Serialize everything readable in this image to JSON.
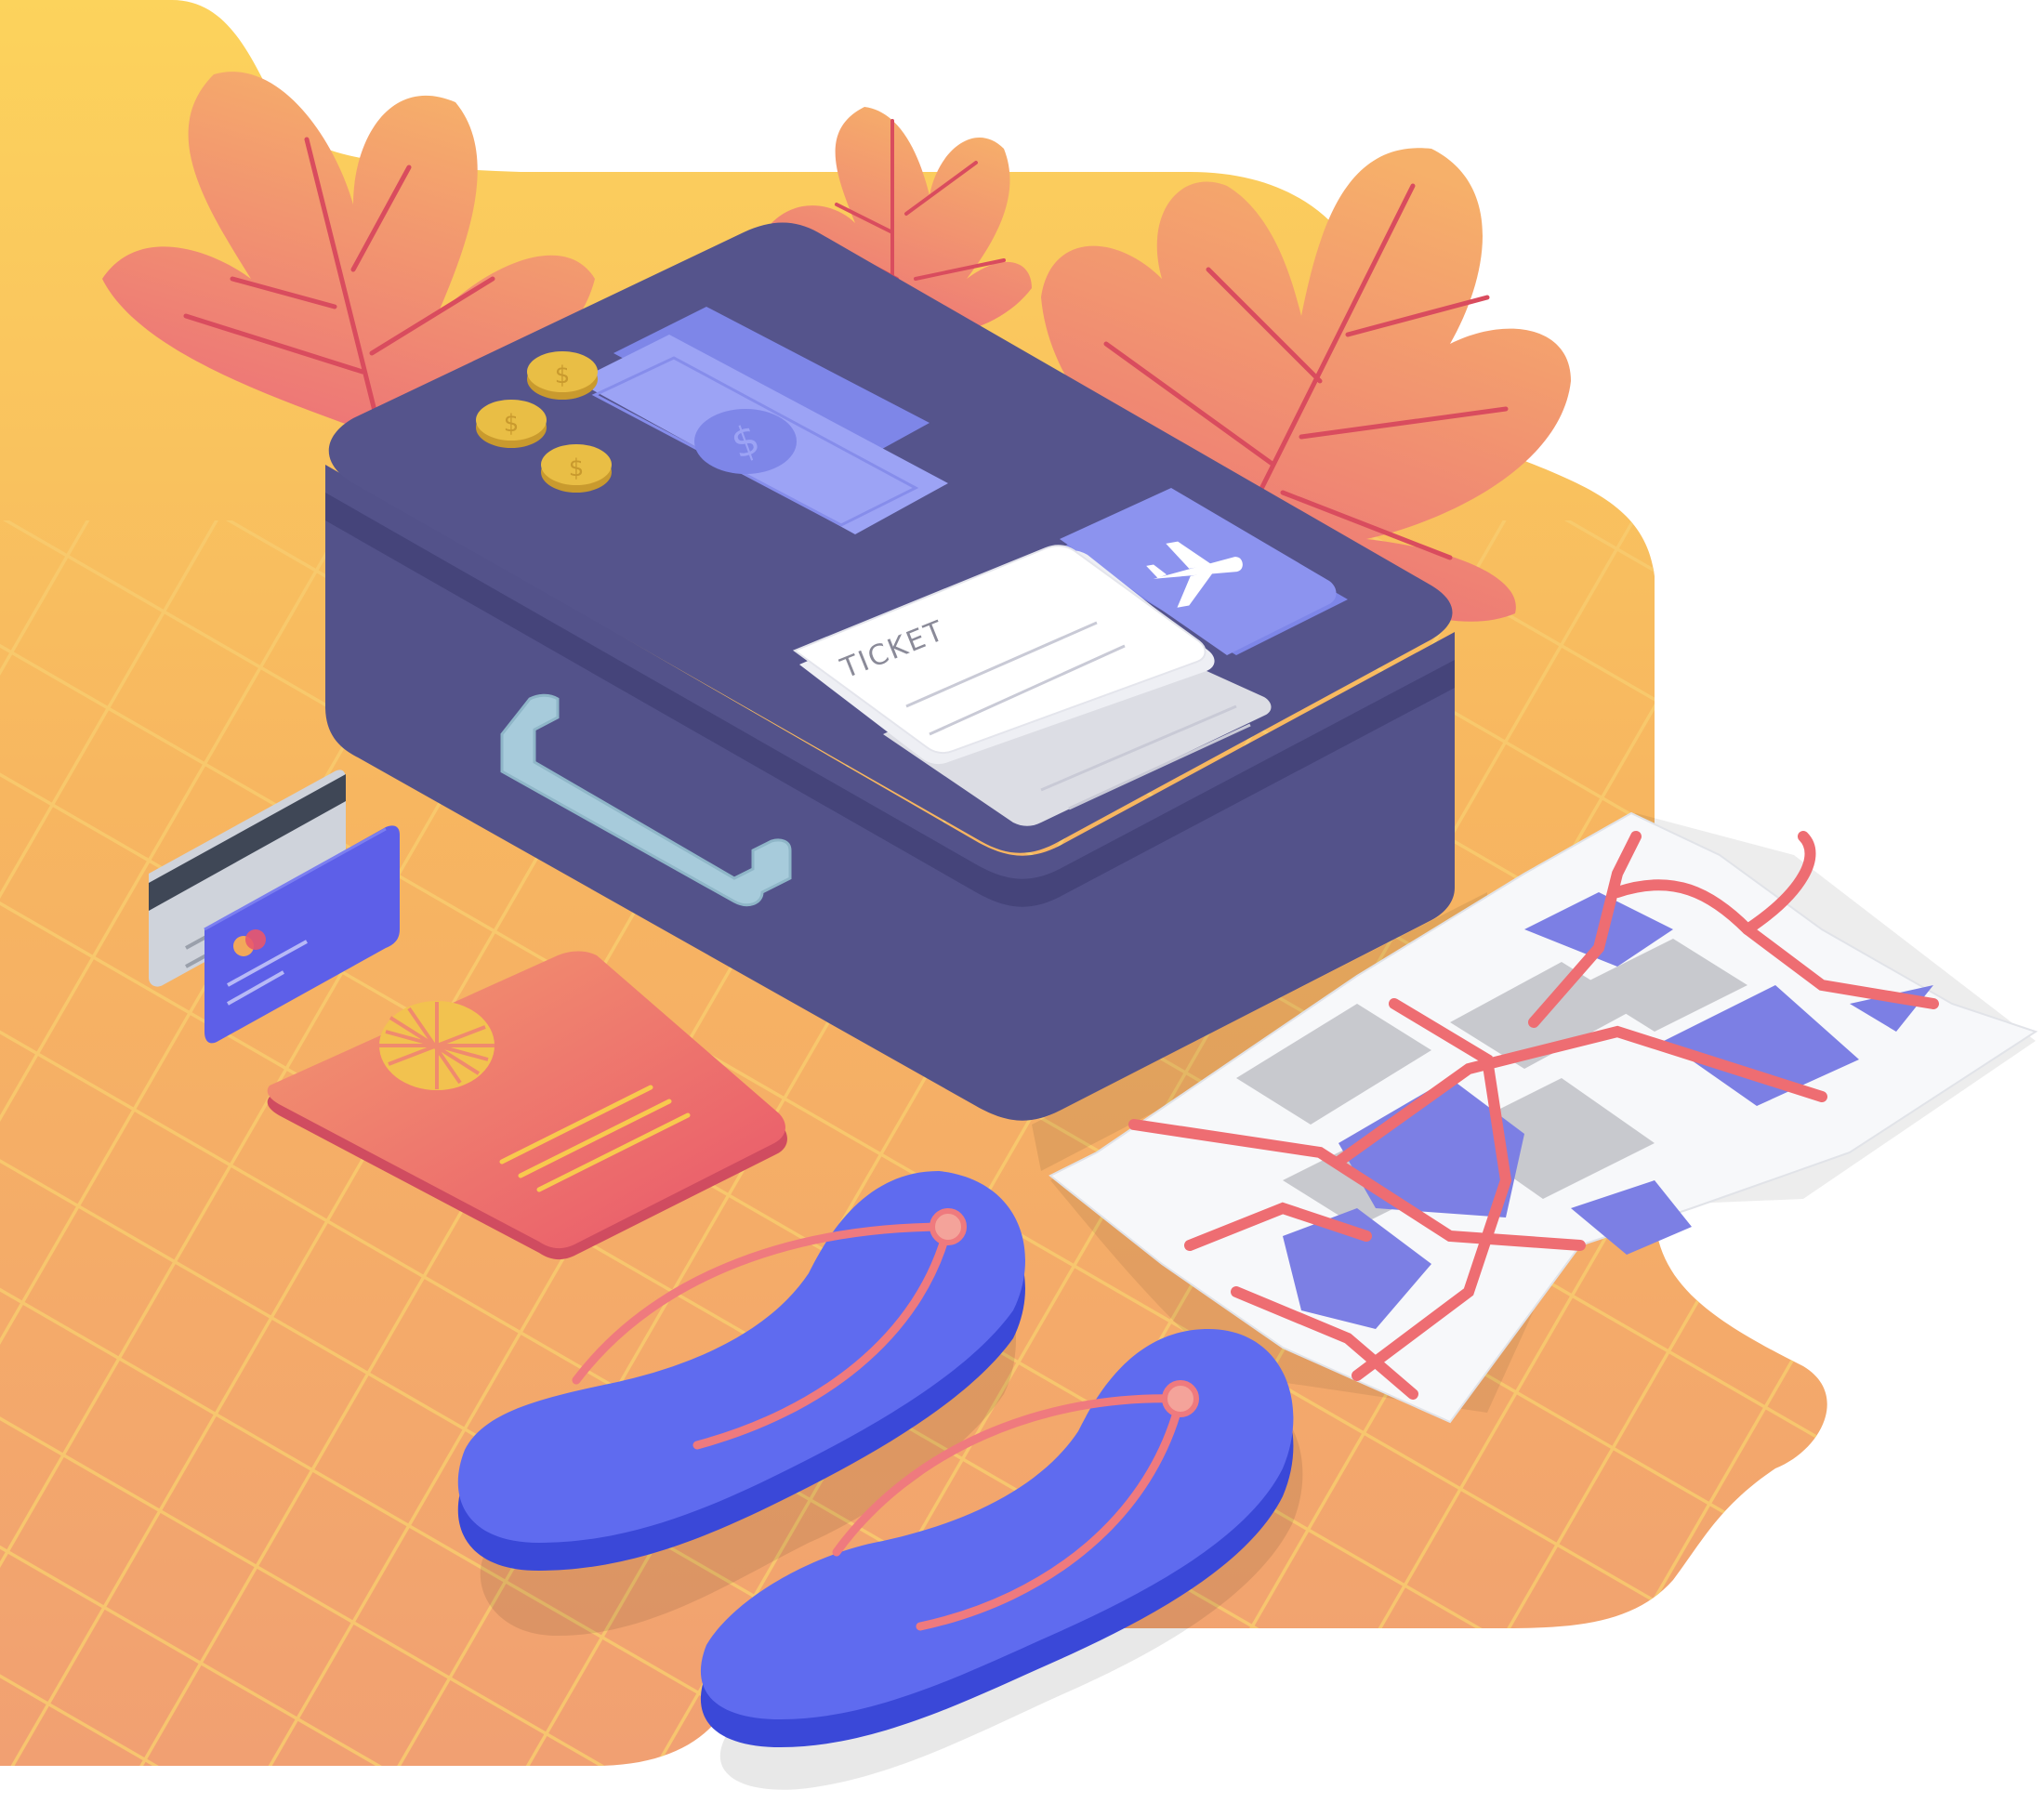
{
  "ticket": {
    "label": "TICKET"
  },
  "money": {
    "currency_symbol": "$"
  },
  "colors": {
    "background_top": "#FCD35C",
    "background_bottom": "#F1A072",
    "grid_lines": "#F7C56A",
    "leaf_top": "#F6A868",
    "leaf_bottom": "#EC6F78",
    "leaf_vein": "#D94C5E",
    "suitcase_top": "#545389",
    "suitcase_side": "#4A4A7E",
    "suitcase_handle": "#A7CBDB",
    "banknote": "#9CA3F5",
    "coin": "#E9BE45",
    "boarding_pass": "#8C93EF",
    "card_blue": "#5D5FE8",
    "card_grey": "#CFD3DB",
    "passport_top": "#F2856D",
    "passport_bottom": "#E9566B",
    "flip_flop": "#5F6BEF",
    "flip_flop_sole": "#3A48D8",
    "flip_flop_strap": "#EF7A7E",
    "map_paper": "#F7F8FA",
    "map_road": "#EE6D72",
    "map_water": "#7C7FE4",
    "map_block": "#C8C9CE"
  },
  "icons": [
    "plane-icon",
    "dollar-icon",
    "globe-icon"
  ]
}
